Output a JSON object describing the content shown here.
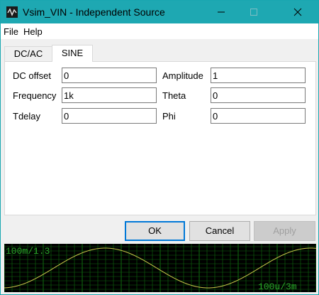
{
  "window": {
    "title": "Vsim_VIN - Independent Source"
  },
  "menu": {
    "file": "File",
    "help": "Help"
  },
  "tabs": {
    "dcac": "DC/AC",
    "sine": "SINE"
  },
  "fields": {
    "dc_offset_label": "DC offset",
    "dc_offset_value": "0",
    "frequency_label": "Frequency",
    "frequency_value": "1k",
    "tdelay_label": "Tdelay",
    "tdelay_value": "0",
    "amplitude_label": "Amplitude",
    "amplitude_value": "1",
    "theta_label": "Theta",
    "theta_value": "0",
    "phi_label": "Phi",
    "phi_value": "0"
  },
  "buttons": {
    "ok": "OK",
    "cancel": "Cancel",
    "apply": "Apply"
  },
  "scope": {
    "top_left_label": "100m/1.3",
    "bottom_right_label": "100u/3m",
    "grid_color": "#0f6b0f",
    "trace_color": "#c8c84a"
  }
}
